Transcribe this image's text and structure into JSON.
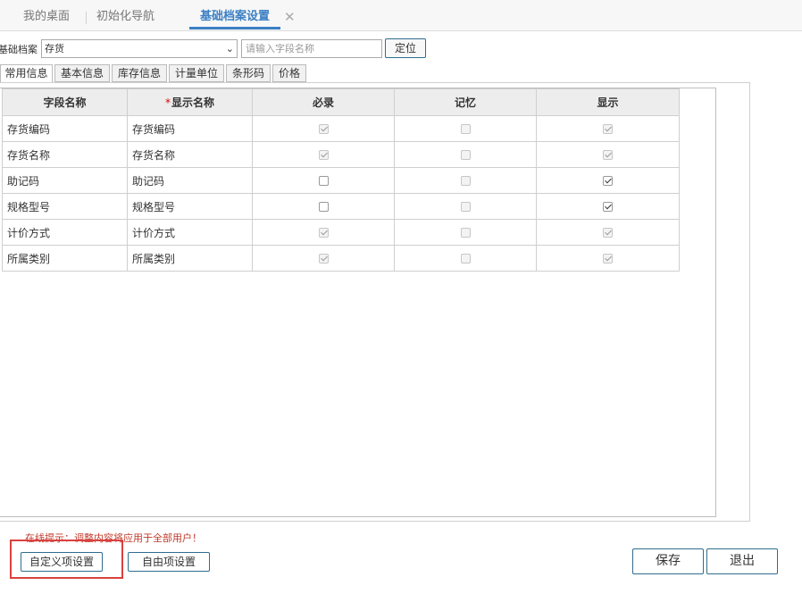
{
  "top_tabs": [
    {
      "label": "我的桌面"
    },
    {
      "label": "初始化导航"
    },
    {
      "label": "基础档案设置",
      "active": true
    }
  ],
  "filter": {
    "label": "基础档案",
    "selected": "存货",
    "search_placeholder": "请输入字段名称",
    "locate_label": "定位"
  },
  "sub_tabs": [
    "常用信息",
    "基本信息",
    "库存信息",
    "计量单位",
    "条形码",
    "价格"
  ],
  "grid": {
    "columns": [
      "字段名称",
      "显示名称",
      "必录",
      "记忆",
      "显示"
    ],
    "required_mark": "*",
    "rows": [
      {
        "field": "存货编码",
        "display": "存货编码",
        "required": {
          "checked": true,
          "disabled": true
        },
        "memory": {
          "checked": false,
          "disabled": true
        },
        "show": {
          "checked": true,
          "disabled": true
        }
      },
      {
        "field": "存货名称",
        "display": "存货名称",
        "required": {
          "checked": true,
          "disabled": true
        },
        "memory": {
          "checked": false,
          "disabled": true
        },
        "show": {
          "checked": true,
          "disabled": true
        }
      },
      {
        "field": "助记码",
        "display": "助记码",
        "required": {
          "checked": false,
          "disabled": false
        },
        "memory": {
          "checked": false,
          "disabled": true
        },
        "show": {
          "checked": true,
          "disabled": false
        }
      },
      {
        "field": "规格型号",
        "display": "规格型号",
        "required": {
          "checked": false,
          "disabled": false
        },
        "memory": {
          "checked": false,
          "disabled": true
        },
        "show": {
          "checked": true,
          "disabled": false
        }
      },
      {
        "field": "计价方式",
        "display": "计价方式",
        "required": {
          "checked": true,
          "disabled": true
        },
        "memory": {
          "checked": false,
          "disabled": true
        },
        "show": {
          "checked": true,
          "disabled": true
        }
      },
      {
        "field": "所属类别",
        "display": "所属类别",
        "required": {
          "checked": true,
          "disabled": true
        },
        "memory": {
          "checked": false,
          "disabled": true
        },
        "show": {
          "checked": true,
          "disabled": true
        }
      }
    ]
  },
  "footer": {
    "hint": "在线提示：调整内容将应用于全部用户！",
    "custom_items_label": "自定义项设置",
    "free_items_label": "自由项设置",
    "save_label": "保存",
    "exit_label": "退出"
  },
  "colors": {
    "accent": "#3b7fc4",
    "highlight_box": "#d9413f",
    "hint_text": "#c0392b"
  }
}
